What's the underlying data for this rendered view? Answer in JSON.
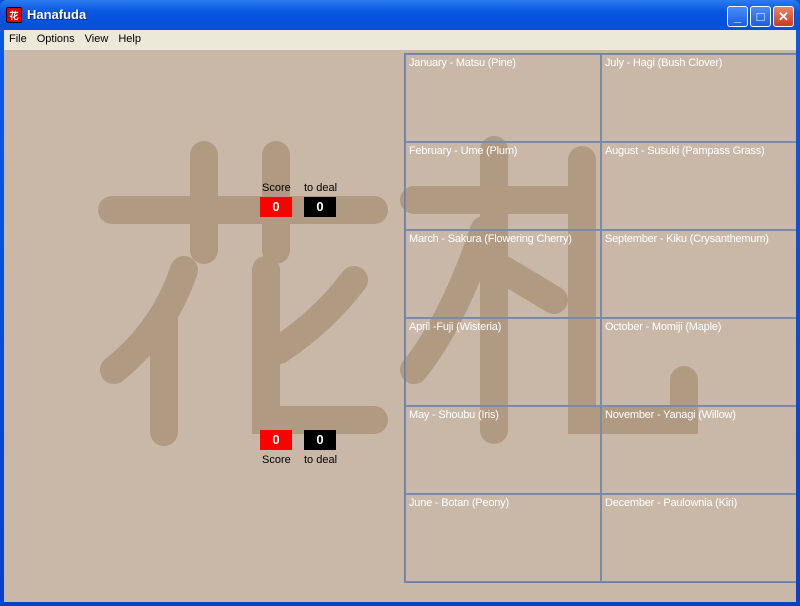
{
  "window": {
    "title": "Hanafuda",
    "logo_text": "花札"
  },
  "menu": [
    "File",
    "Options",
    "View",
    "Help"
  ],
  "opponent": {
    "score_label": "Score",
    "deal_label": "to deal",
    "score": "0",
    "to_deal": "0"
  },
  "player": {
    "score_label": "Score",
    "deal_label": "to deal",
    "score": "0",
    "to_deal": "0"
  },
  "months": [
    "January - Matsu (Pine)",
    "July - Hagi (Bush Clover)",
    "February - Ume (Plum)",
    "August - Susuki (Pampass Grass)",
    "March - Sakura (Flowering Cherry)",
    "September - Kiku (Crysanthemum)",
    "April -Fuji (Wisteria)",
    "October - Momiji (Maple)",
    "May - Shoubu (Iris)",
    "November - Yanagi (Willow)",
    "June - Botan (Peony)",
    "December - Paulownia (Kiri)"
  ],
  "colors": {
    "background": "#c9b8a8",
    "kanji": "#b09a82",
    "score": "#ff0000",
    "deal": "#000000"
  }
}
